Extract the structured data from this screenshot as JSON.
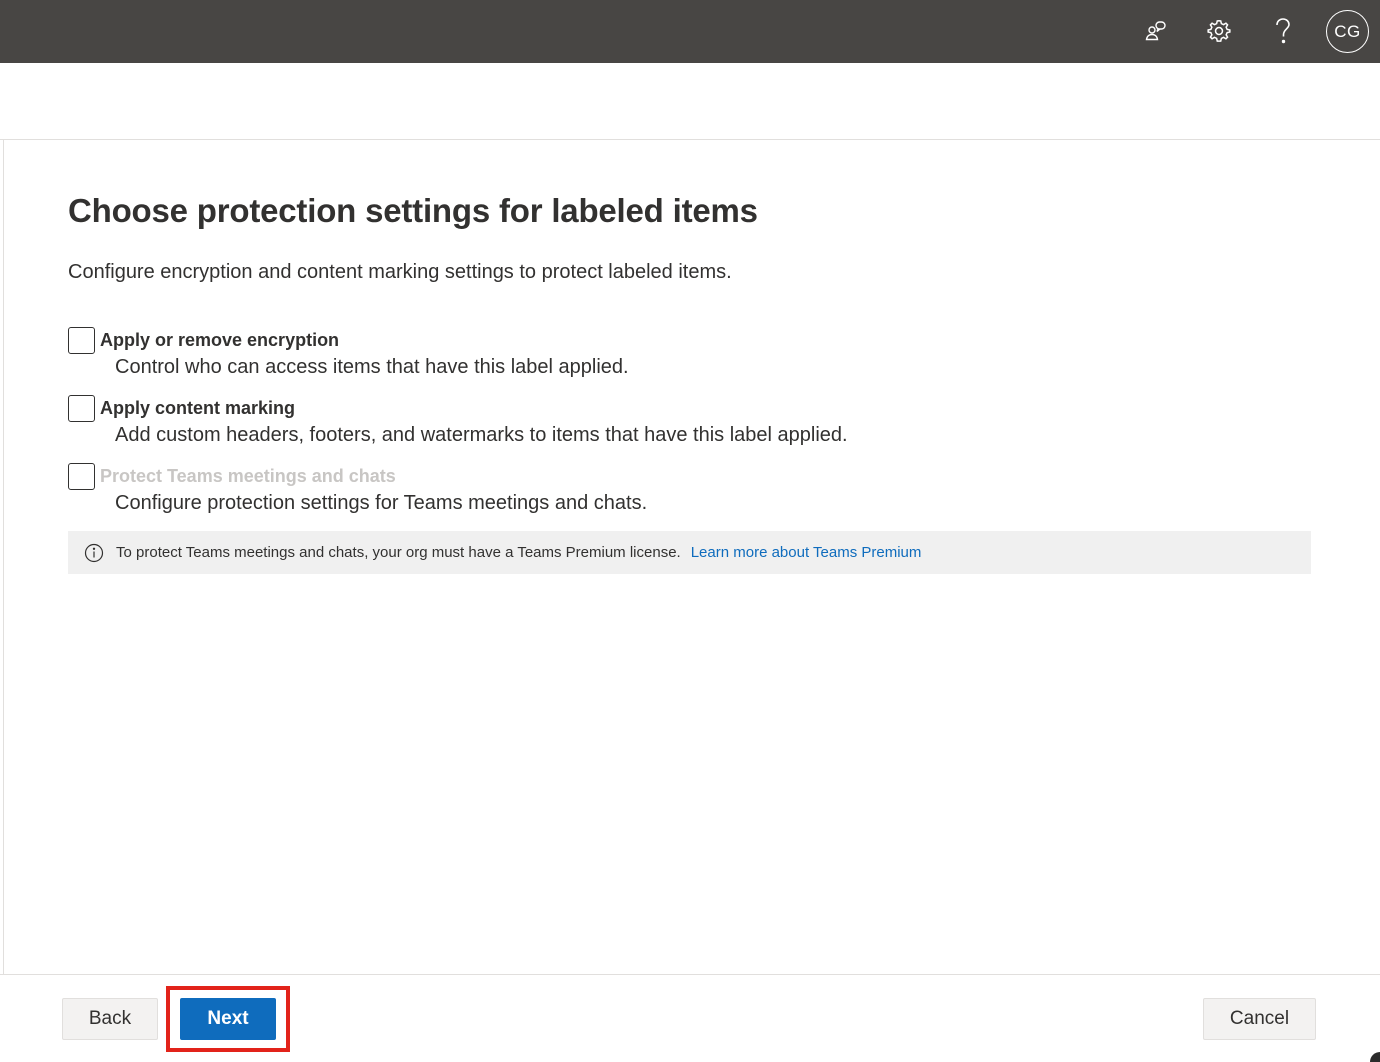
{
  "topbar": {
    "icons": [
      "people-icon",
      "gear-icon",
      "help-icon"
    ],
    "avatar_initials": "CG",
    "background": "#484644"
  },
  "main": {
    "title": "Choose protection settings for labeled items",
    "description": "Configure encryption and content marking settings to protect labeled items.",
    "options": [
      {
        "label": "Apply or remove encryption",
        "description": "Control who can access items that have this label applied.",
        "checked": false,
        "disabled": false
      },
      {
        "label": "Apply content marking",
        "description": "Add custom headers, footers, and watermarks to items that have this label applied.",
        "checked": false,
        "disabled": false
      },
      {
        "label": "Protect Teams meetings and chats",
        "description": "Configure protection settings for Teams meetings and chats.",
        "checked": false,
        "disabled": true
      }
    ],
    "info": {
      "text": "To protect Teams meetings and chats, your org must have a Teams Premium license.",
      "link_text": "Learn more about Teams Premium"
    }
  },
  "footer": {
    "back_label": "Back",
    "next_label": "Next",
    "cancel_label": "Cancel"
  },
  "colors": {
    "accent": "#0f6cbd",
    "highlight": "#e2231a",
    "info_background": "#f0f0f0"
  }
}
